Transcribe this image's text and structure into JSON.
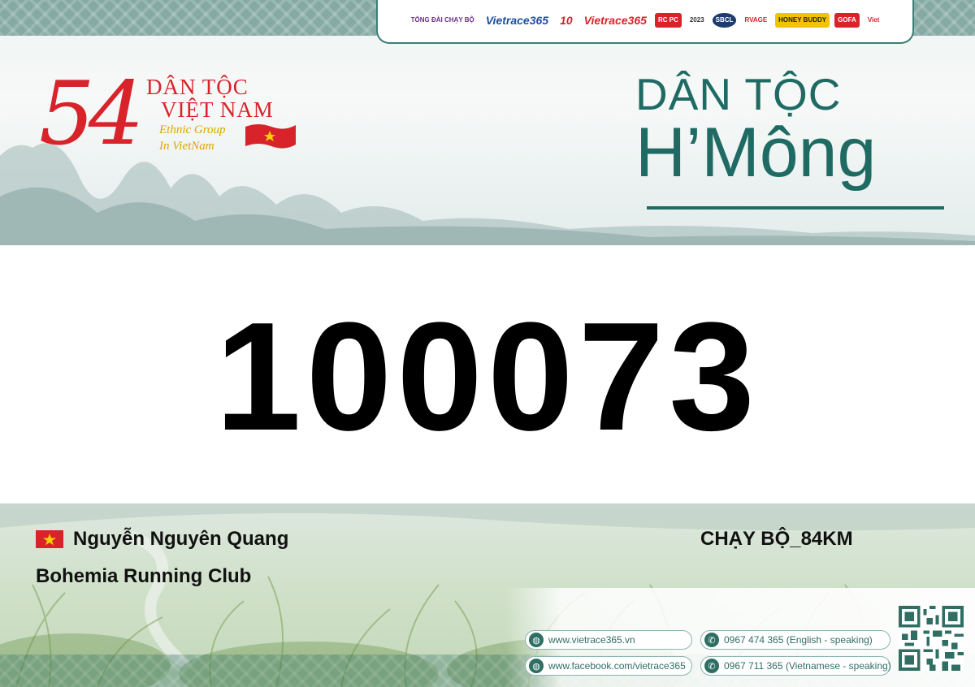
{
  "sponsors": [
    "TỔNG ĐÀI CHẠY BỘ",
    "Vietrace365",
    "10",
    "Vietrace365",
    "RC PC",
    "2023",
    "SBCL",
    "RVAGE",
    "HONEY BUDDY",
    "GOFA",
    "Viet"
  ],
  "logo_54": {
    "number": "54",
    "line1": "DÂN TỘC",
    "line2": "VIỆT NAM",
    "line3": "Ethnic Group",
    "line4": "In VietNam"
  },
  "ethnic_title": {
    "line1": "DÂN TỘC",
    "line2": "H’Mông"
  },
  "bib_number": "100073",
  "runner": {
    "name": "Nguyễn Nguyên Quang",
    "club": "Bohemia Running Club",
    "category": "CHẠY BỘ_84KM"
  },
  "contacts": {
    "website": "www.vietrace365.vn",
    "facebook": "www.facebook.com/vietrace365",
    "phone_en": "0967 474 365 (English - speaking)",
    "phone_vi": "0967 711 365 (Vietnamese - speaking)"
  },
  "colors": {
    "brand_teal": "#1f6b64",
    "logo_red": "#d8232a",
    "logo_gold": "#e0a400"
  },
  "icons": [
    "globe-icon",
    "phone-icon",
    "qr-code",
    "vn-flag"
  ]
}
